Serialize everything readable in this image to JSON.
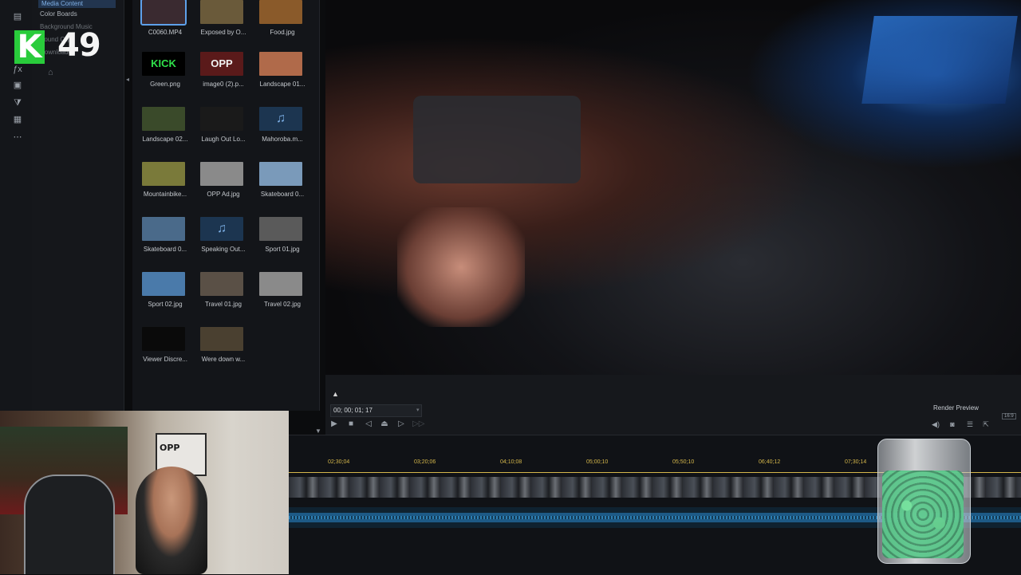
{
  "rooms": {
    "items": [
      {
        "label": "Media Content",
        "active": true
      },
      {
        "label": "Color Boards"
      },
      {
        "label": "Background Music"
      },
      {
        "label": "Sound Clips"
      },
      {
        "label": "Downloaded"
      }
    ]
  },
  "library": {
    "tiles": [
      {
        "label": "C0060.MP4",
        "kind": "video",
        "color": "#3a2a30"
      },
      {
        "label": "Exposed by O...",
        "kind": "image",
        "color": "#6a5a3a"
      },
      {
        "label": "Food.jpg",
        "kind": "image",
        "color": "#8a5a2a"
      },
      {
        "label": "Green.png",
        "kind": "image",
        "color": "#000000",
        "text": "KICK"
      },
      {
        "label": "image0 (2).p...",
        "kind": "image",
        "color": "#5a1a1a",
        "text": "OPP"
      },
      {
        "label": "Landscape 01...",
        "kind": "image",
        "color": "#b06a4a"
      },
      {
        "label": "Landscape 02...",
        "kind": "image",
        "color": "#3a4a2a"
      },
      {
        "label": "Laugh Out Lo...",
        "kind": "image",
        "color": "#1a1a1a"
      },
      {
        "label": "Mahoroba.m...",
        "kind": "music",
        "icon": "♫"
      },
      {
        "label": "Mountainbike...",
        "kind": "video",
        "color": "#7a7a3a"
      },
      {
        "label": "OPP Ad.jpg",
        "kind": "image",
        "color": "#8a8a8a"
      },
      {
        "label": "Skateboard 0...",
        "kind": "video",
        "color": "#7a9aba"
      },
      {
        "label": "Skateboard 0...",
        "kind": "video",
        "color": "#4a6a8a"
      },
      {
        "label": "Speaking Out...",
        "kind": "music",
        "icon": "♫"
      },
      {
        "label": "Sport 01.jpg",
        "kind": "image",
        "color": "#5a5a5a"
      },
      {
        "label": "Sport 02.jpg",
        "kind": "image",
        "color": "#4a7aaa"
      },
      {
        "label": "Travel 01.jpg",
        "kind": "image",
        "color": "#5a5046"
      },
      {
        "label": "Travel 02.jpg",
        "kind": "image",
        "color": "#8a8a8a"
      },
      {
        "label": "Viewer Discre...",
        "kind": "image",
        "color": "#0a0a0a"
      },
      {
        "label": "Were down w...",
        "kind": "image",
        "color": "#4a4030"
      }
    ]
  },
  "player": {
    "timecode": "00; 00; 01; 17",
    "render_preview": "Render Preview",
    "aspect": "16:9"
  },
  "timeline": {
    "ticks": [
      "02;30;04",
      "03;20;06",
      "04;10;08",
      "05;00;10",
      "05;50;10",
      "06;40;12",
      "07;30;14"
    ]
  },
  "overlay": {
    "logo_letter": "K",
    "logo_number": "49",
    "poster_text": "OPP"
  },
  "colors": {
    "accent": "#5ea1ea",
    "ruler": "#d5b74b",
    "logo_green": "#29cc3b"
  }
}
